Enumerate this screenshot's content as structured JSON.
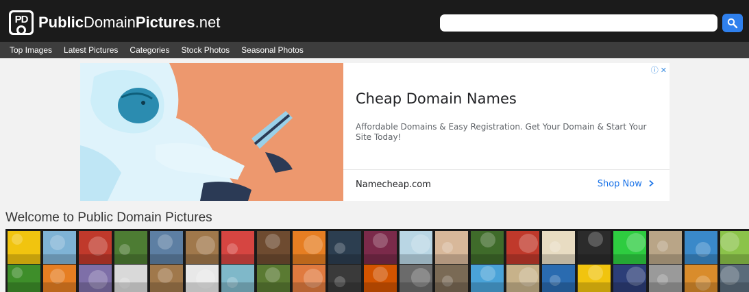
{
  "header": {
    "logo_badge": "PD",
    "logo_bold_1": "Public",
    "logo_thin": "Domain",
    "logo_bold_2": "Pictures",
    "logo_suffix": ".net",
    "search_placeholder": "",
    "search_icon": "search-icon",
    "colors": {
      "topbar": "#1b1b1b",
      "navbar": "#3d3d3d",
      "search_button": "#2f80ed"
    }
  },
  "nav": {
    "items": [
      {
        "label": "Top Images"
      },
      {
        "label": "Latest Pictures"
      },
      {
        "label": "Categories"
      },
      {
        "label": "Stock Photos"
      },
      {
        "label": "Seasonal Photos"
      }
    ]
  },
  "ad": {
    "choices": "ⓘ ✕",
    "title": "Cheap Domain Names",
    "description": "Affordable Domains & Easy Registration. Get Your Domain & Start Your Site Today!",
    "domain": "Namecheap.com",
    "cta": "Shop Now",
    "cta_icon": "chevron-right-icon"
  },
  "main": {
    "welcome": "Welcome to Public Domain Pictures"
  },
  "gallery": {
    "row1": [
      {
        "name": "sunburst",
        "color": "#f1c40f"
      },
      {
        "name": "blue-eye",
        "color": "#7fb3d5"
      },
      {
        "name": "red-flower",
        "color": "#c0392b"
      },
      {
        "name": "leaves",
        "color": "#4d7c33"
      },
      {
        "name": "wind-turbines",
        "color": "#5d7fa3"
      },
      {
        "name": "wood",
        "color": "#a0784b"
      },
      {
        "name": "santa-girl",
        "color": "#d64541"
      },
      {
        "name": "coffee-beans",
        "color": "#6e4b30"
      },
      {
        "name": "orange-slice",
        "color": "#e67e22"
      },
      {
        "name": "tower-bridge",
        "color": "#2c3e50"
      },
      {
        "name": "berries",
        "color": "#7b2a4a"
      },
      {
        "name": "ice",
        "color": "#b9d6e4"
      },
      {
        "name": "family",
        "color": "#d8b89a"
      },
      {
        "name": "butterfly",
        "color": "#3f6b2a"
      },
      {
        "name": "tulips",
        "color": "#c0392b"
      },
      {
        "name": "sheet-music",
        "color": "#e8dcc2"
      },
      {
        "name": "moon",
        "color": "#2b2b2b"
      },
      {
        "name": "green-screen",
        "color": "#2ecc40"
      },
      {
        "name": "stone-wall",
        "color": "#b9a587"
      },
      {
        "name": "pier",
        "color": "#3a89c9"
      },
      {
        "name": "meadow",
        "color": "#8bc34a"
      }
    ],
    "row2": [
      {
        "name": "grass",
        "color": "#3e8e2a"
      },
      {
        "name": "pumpkin",
        "color": "#e67e22"
      },
      {
        "name": "lamp",
        "color": "#7e6fa8"
      },
      {
        "name": "pencils",
        "color": "#d9d9d9"
      },
      {
        "name": "wooden-heart",
        "color": "#a0784b"
      },
      {
        "name": "help-key",
        "color": "#e8e8e8"
      },
      {
        "name": "beach",
        "color": "#7fb8c9"
      },
      {
        "name": "deer",
        "color": "#5a7a32"
      },
      {
        "name": "peaches",
        "color": "#e07a3f"
      },
      {
        "name": "woman-portrait",
        "color": "#3a3a3a"
      },
      {
        "name": "sunset-tree",
        "color": "#d35400"
      },
      {
        "name": "elephant",
        "color": "#6b6b6b"
      },
      {
        "name": "cathedral",
        "color": "#7a6a55"
      },
      {
        "name": "tropical-beach",
        "color": "#4aa3d8"
      },
      {
        "name": "woman-flowers",
        "color": "#c7b28a"
      },
      {
        "name": "blue-butterfly",
        "color": "#2a6bb0"
      },
      {
        "name": "flower-field",
        "color": "#f1c40f"
      },
      {
        "name": "solar-panels",
        "color": "#2c3e78"
      },
      {
        "name": "einstein",
        "color": "#9a9a9a"
      },
      {
        "name": "autumn-lake",
        "color": "#d98c2b"
      },
      {
        "name": "stingray",
        "color": "#5a6b7a"
      }
    ]
  }
}
